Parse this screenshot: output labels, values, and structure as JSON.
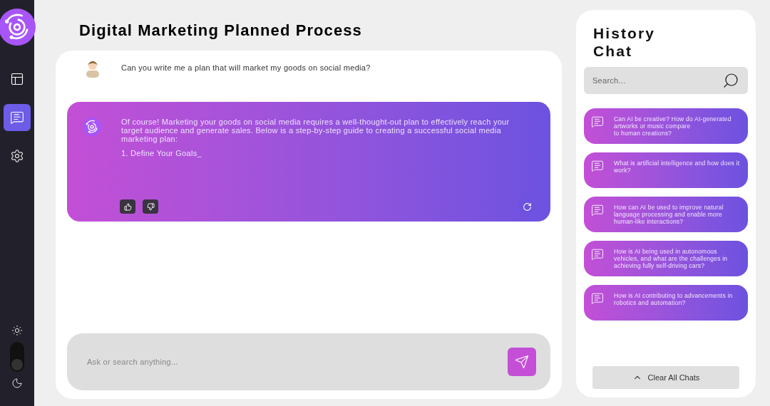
{
  "sidebar": {
    "items": [
      {
        "kind": "layout",
        "selected": false
      },
      {
        "kind": "chat",
        "selected": true
      },
      {
        "kind": "settings",
        "selected": false
      }
    ],
    "theme_toggle": {
      "dark": true
    }
  },
  "title": "Digital Marketing Planned Process",
  "conversation": {
    "question": "Can you write me a plan that will market my goods on social media?",
    "answer": {
      "paragraph": "Of course! Marketing your goods on social media requires a well-thought-out plan to effectively reach your target audience and generate sales. Below is a step-by-step guide to creating a successful social media marketing plan:",
      "step": "1. Define Your Goals_"
    }
  },
  "composer": {
    "placeholder": "Ask or search anything..."
  },
  "history": {
    "title": "History Chat",
    "search": {
      "placeholder": "Search..."
    },
    "items": [
      {
        "text": "Can AI be creative? How do AI-generated artworks or music compare\nto human creations?"
      },
      {
        "text": "What is artificial intelligence and how does it work?"
      },
      {
        "text": "How can AI be used to improve natural language processing and enable more human-like interactions?"
      },
      {
        "text": "How is AI being used in autonomous vehicles, and what are the challenges in achieving fully self-driving cars?"
      },
      {
        "text": "How is AI contributing to advancements in robotics and automation?"
      }
    ],
    "clear_button": "Clear All Chats"
  }
}
